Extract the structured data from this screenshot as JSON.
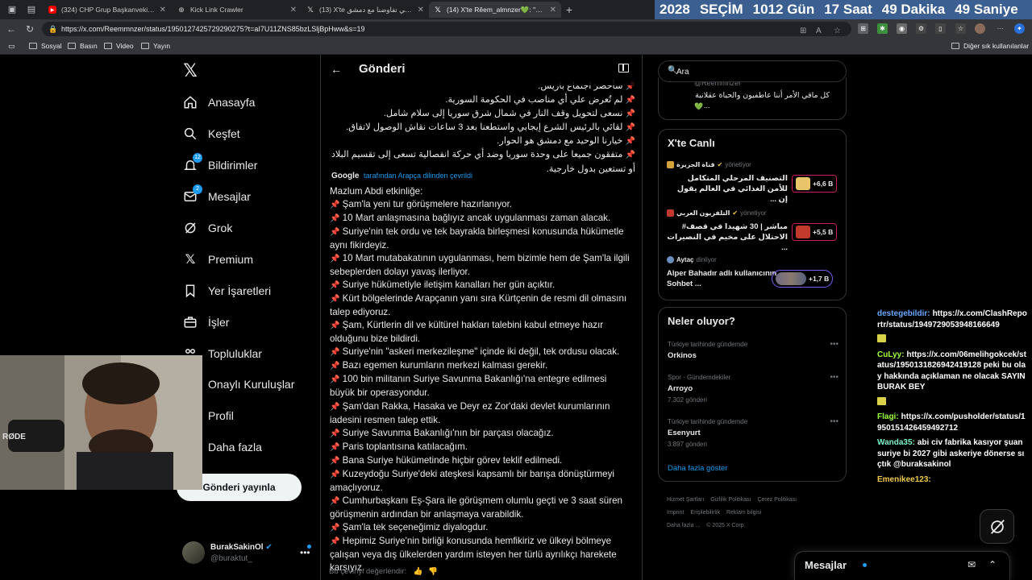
{
  "browser": {
    "tabs": [
      {
        "title": "(324) CHP Grup Başkanvekili Ali Mahir",
        "icon": "youtube-icon",
        "active": false
      },
      {
        "title": "Kick Link Crawler",
        "icon": "globe-icon",
        "active": false
      },
      {
        "title": "(13) X'te علي بط: \"في تفاوضنا مع دمشق\"",
        "icon": "x-icon",
        "active": false
      },
      {
        "title": "(14) X'te Rêem_almnzer💚: \"جولة\"",
        "icon": "x-icon",
        "active": true
      }
    ],
    "url": "https://x.com/Reemmnzer/status/1950127425729290275?t=aI7U11ZNS85bzLSljBpHww&s=19",
    "bookmarks": [
      "Sosyal",
      "Basın",
      "Video",
      "Yayın"
    ],
    "other_bookmarks": "Diğer sık kullanılanlar"
  },
  "countdown": {
    "year": "2028",
    "label": "SEÇİM",
    "days": "1012 Gün",
    "hours": "17 Saat",
    "minutes": "49 Dakika",
    "seconds": "49 Saniye"
  },
  "nav": {
    "items": [
      {
        "label": "Anasayfa",
        "icon": "home-icon"
      },
      {
        "label": "Keşfet",
        "icon": "search-icon"
      },
      {
        "label": "Bildirimler",
        "icon": "bell-icon",
        "badge": "12"
      },
      {
        "label": "Mesajlar",
        "icon": "mail-icon",
        "badge": "2"
      },
      {
        "label": "Grok",
        "icon": "grok-icon"
      },
      {
        "label": "Premium",
        "icon": "x-premium-icon"
      },
      {
        "label": "Yer İşaretleri",
        "icon": "bookmark-icon"
      },
      {
        "label": "İşler",
        "icon": "briefcase-icon"
      },
      {
        "label": "Topluluklar",
        "icon": "people-icon"
      },
      {
        "label": "Onaylı Kuruluşlar",
        "icon": "verified-org-icon"
      },
      {
        "label": "Profil",
        "icon": "person-icon"
      },
      {
        "label": "Daha fazla",
        "icon": "more-circle-icon"
      }
    ],
    "post_button": "Gönderi yayınla",
    "account": {
      "name": "BurakSakinOl",
      "handle": "@buraktut_"
    }
  },
  "main": {
    "title": "Gönderi",
    "arabic_lines": [
      "سأحضر اجتماع باريس.",
      "لم تُعرض علي أي مناصب في الحكومة السورية.",
      "نسعى لتحويل وقف النار في شمال شرق سوريا إلى سلام شامل.",
      "لقائي بالرئيس الشرع إيجابي واستطعنا بعد 3 ساعات نقاش الوصول لاتفاق.",
      "خيارنا الوحيد مع دمشق هو الحوار.",
      "متفقون جميعا على وحدة سوريا وضد أي حركة انفصالية تسعى إلى تقسيم البلاد",
      "أو تستعين بدول خارجية."
    ],
    "translated_by": {
      "google": "Google",
      "text": "tarafından Arapça dilinden çevrildi"
    },
    "translation_lines": [
      "Mazlum Abdi etkinliğe:",
      "📌 Şam'la yeni tur görüşmelere hazırlanıyor.",
      "📌 10 Mart anlaşmasına bağlıyız ancak uygulanması zaman alacak.",
      "📌 Suriye'nin tek ordu ve tek bayrakla birleşmesi konusunda hükümetle",
      "aynı fikirdeyiz.",
      "📌 10 Mart mutabakatının uygulanması, hem bizimle hem de Şam'la ilgili",
      "sebeplerden dolayı yavaş ilerliyor.",
      "📌 Suriye hükümetiyle iletişim kanalları her gün açıktır.",
      "📌 Kürt bölgelerinde Arapçanın yanı sıra Kürtçenin de resmi dil olmasını",
      "talep ediyoruz.",
      "📌 Şam, Kürtlerin dil ve kültürel hakları talebini kabul etmeye hazır",
      "olduğunu bize bildirdi.",
      "📌 Suriye'nin \"askeri merkezileşme\" içinde iki değil, tek ordusu olacak.",
      "📌 Bazı egemen kurumların merkezi kalması gerekir.",
      "📌 100 bin militanın Suriye Savunma Bakanlığı'na entegre edilmesi",
      "büyük bir operasyondur.",
      "📌 Şam'dan Rakka, Hasaka ve Deyr ez Zor'daki devlet kurumlarının",
      "iadesini resmen talep ettik.",
      "📌 Suriye Savunma Bakanlığı'nın bir parçası olacağız.",
      "📌 Paris toplantısına katılacağım.",
      "📌 Bana Suriye hükümetinde hiçbir görev teklif edilmedi.",
      "📌 Kuzeydoğu Suriye'deki ateşkesi kapsamlı bir barışa dönüştürmeyi",
      "amaçlıyoruz.",
      "📌 Cumhurbaşkanı Eş-Şara ile görüşmem olumlu geçti ve 3 saat süren",
      "görüşmenin ardından bir anlaşmaya varabildik.",
      "📌 Şam'la tek seçeneğimiz diyalogdur.",
      "📌 Hepimiz Suriye'nin birliği konusunda hemfikiriz ve ülkeyi bölmeye",
      "çalışan veya dış ülkelerden yardım isteyen her türlü ayrılıkçı harekete",
      "karşıyız."
    ],
    "rate_translation": "Bu çeviriyi değerlendir:"
  },
  "right": {
    "search_placeholder": "Ara",
    "top_card": {
      "handle": "@Reemmnzer",
      "text": "كل ماقي الأمر أننا عاطفيون والحياة عقلانية",
      "ellipsis": "..."
    },
    "live": {
      "title": "X'te Canlı",
      "items": [
        {
          "source": "قناة الجزيرة",
          "role": "yönetiyor",
          "headline": "التصنيف المرحلي المتكامل للأمن الغذائي في العالم يقول إن ...",
          "count": "+6,6 B",
          "rtl": true
        },
        {
          "source": "التلفزيون العربي",
          "role": "yönetiyor",
          "headline": "مباشر | 30 شهيدا في قصف# الاحتلال على مخيم في النصيرات ...",
          "count": "+5,5 B",
          "rtl": true
        },
        {
          "source": "Aytaç",
          "role": "dinliyor",
          "headline": "Alper Bahadır adlı kullanıcının Sohbet ...",
          "count": "+1,7 B",
          "rtl": false
        }
      ]
    },
    "trends": {
      "title": "Neler oluyor?",
      "items": [
        {
          "category": "Türkiye tarihinde gündemde",
          "name": "Orkinos",
          "count": ""
        },
        {
          "category": "Spor · Gündemdekiler",
          "name": "Arroyo",
          "count": "7.302 gönderi"
        },
        {
          "category": "Türkiye tarihinde gündemde",
          "name": "Esenyurt",
          "count": "3.897 gönderi"
        }
      ],
      "show_more": "Daha fazla göster"
    },
    "footer": [
      "Hizmet Şartları",
      "Gizlilik Politikası",
      "Çerez Politikası",
      "Imprint",
      "Erişilebilirlik",
      "Reklam bilgisi",
      "Daha fazla ...",
      "© 2025 X Corp."
    ]
  },
  "chat": [
    {
      "user": "destegebildir:",
      "text": "https://x.com/ClashReportr/status/1949729053948166649",
      "color": "#6aa8ff",
      "emote": false
    },
    {
      "user": "CuLyy:",
      "text": "https://x.com/06melihgokcek/status/1950131826942419128 peki bu olay hakkında açıklaman ne olacak SAYIN BURAK BEY",
      "color": "#9aff3b",
      "emote": true
    },
    {
      "user": "Flagi:",
      "text": "https://x.com/pusholder/status/1950151426459492712",
      "color": "#9aff3b",
      "emote": true
    },
    {
      "user": "Wanda35:",
      "text": "abi civ fabrika kasıyor şuan suriye bi 2027 gibi askeriye dönerse sıçtık @buraksakinol",
      "color": "#7cf0c8",
      "emote": false
    },
    {
      "user": "Emenikee123:",
      "text": "",
      "color": "#f0c94a",
      "emote": false
    }
  ],
  "messages_bar": {
    "title": "Mesajlar"
  }
}
